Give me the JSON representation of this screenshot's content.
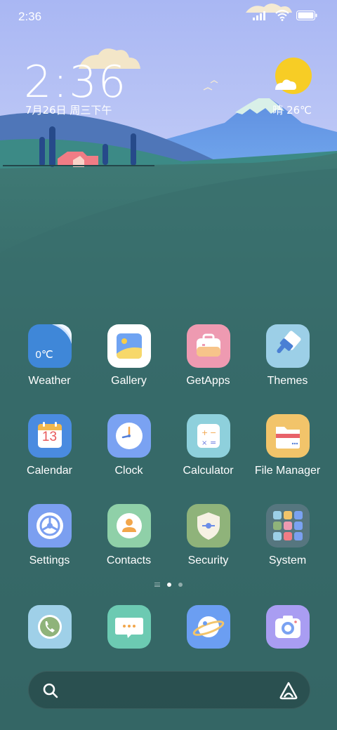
{
  "status_bar": {
    "time": "2:36",
    "battery_level": 0.95
  },
  "widget": {
    "clock": "2:36",
    "date": "7月26日 周三下午",
    "weather": "晴 26℃"
  },
  "apps": [
    {
      "name": "weather",
      "label": "Weather",
      "icon_text": "0℃"
    },
    {
      "name": "gallery",
      "label": "Gallery"
    },
    {
      "name": "getapps",
      "label": "GetApps"
    },
    {
      "name": "themes",
      "label": "Themes"
    },
    {
      "name": "calendar",
      "label": "Calendar",
      "icon_text": "13"
    },
    {
      "name": "clock",
      "label": "Clock"
    },
    {
      "name": "calculator",
      "label": "Calculator"
    },
    {
      "name": "file-manager",
      "label": "File Manager"
    },
    {
      "name": "settings",
      "label": "Settings"
    },
    {
      "name": "contacts",
      "label": "Contacts"
    },
    {
      "name": "security",
      "label": "Security"
    },
    {
      "name": "system",
      "label": "System"
    }
  ],
  "dock": [
    "phone",
    "messages",
    "browser",
    "camera"
  ],
  "page_indicator": {
    "pages": 2,
    "current": 1
  }
}
